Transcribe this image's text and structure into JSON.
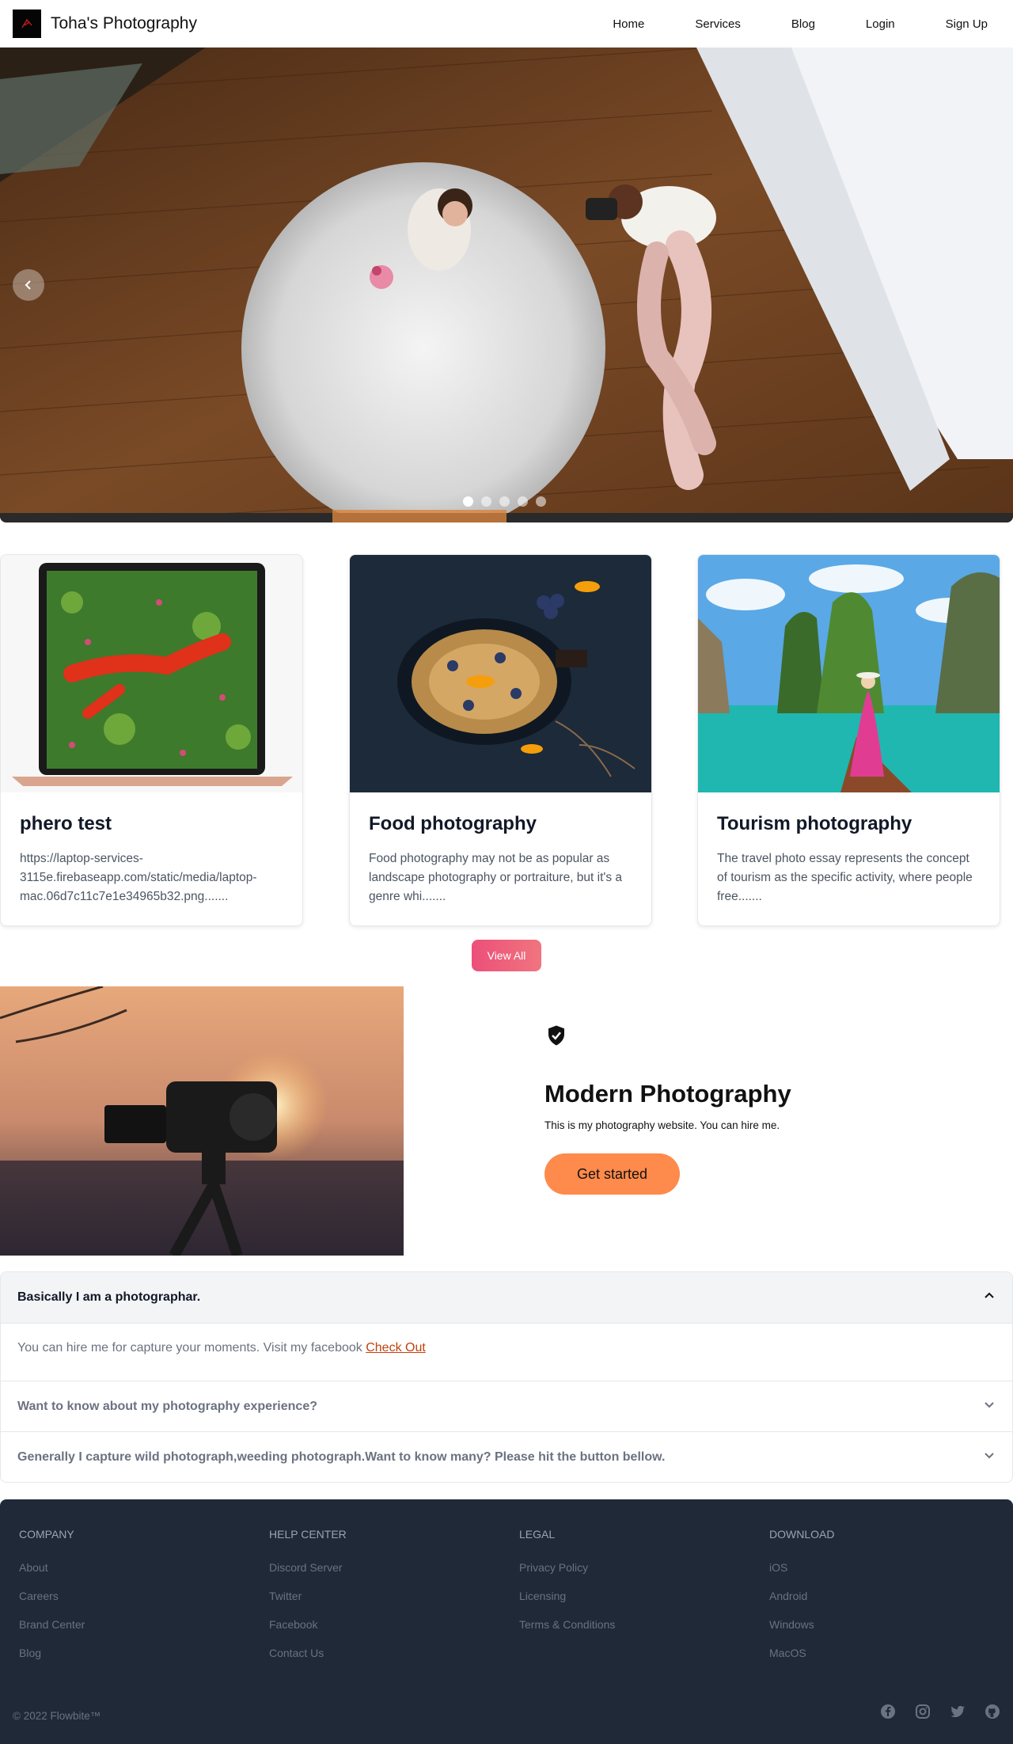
{
  "navbar": {
    "brand": "Toha's Photography",
    "links": [
      "Home",
      "Services",
      "Blog",
      "Login",
      "Sign Up"
    ]
  },
  "carousel": {
    "slide_count": 5,
    "active_index": 0
  },
  "cards": [
    {
      "title": "phero test",
      "text": "https://laptop-services-3115e.firebaseapp.com/static/media/laptop-mac.06d7c11c7e1e34965b32.png......."
    },
    {
      "title": "Food photography",
      "text": "Food photography may not be as popular as landscape photography or portraiture, but it's a genre whi......."
    },
    {
      "title": "Tourism photography",
      "text": "The travel photo essay represents the concept of tourism as the specific activity, where people free......."
    }
  ],
  "view_all_label": "View All",
  "feature": {
    "title": "Modern Photography",
    "subtitle": "This is my photography website. You can hire me.",
    "button": "Get started"
  },
  "accordion": {
    "items": [
      {
        "title": "Basically I am a photographar.",
        "open": true
      },
      {
        "title": "Want to know about my photography experience?",
        "open": false
      },
      {
        "title": "Generally I capture wild photograph,weeding photograph.Want to know many? Please hit the button bellow.",
        "open": false
      }
    ],
    "body_text": "You can hire me for capture your moments. Visit my facebook ",
    "body_link": "Check Out"
  },
  "footer": {
    "columns": [
      {
        "heading": "Company",
        "links": [
          "About",
          "Careers",
          "Brand Center",
          "Blog"
        ]
      },
      {
        "heading": "Help center",
        "links": [
          "Discord Server",
          "Twitter",
          "Facebook",
          "Contact Us"
        ]
      },
      {
        "heading": "Legal",
        "links": [
          "Privacy Policy",
          "Licensing",
          "Terms & Conditions"
        ]
      },
      {
        "heading": "Download",
        "links": [
          "iOS",
          "Android",
          "Windows",
          "MacOS"
        ]
      }
    ],
    "copyright": "© 2022 Flowbite™",
    "socials": [
      "facebook-icon",
      "instagram-icon",
      "twitter-icon",
      "github-icon"
    ]
  },
  "colors": {
    "footer_bg": "#1f2937",
    "view_all_gradient": [
      "#ec4f79",
      "#f0757f"
    ],
    "get_started": "#fe8a4b",
    "link_accent": "#c2410c"
  }
}
